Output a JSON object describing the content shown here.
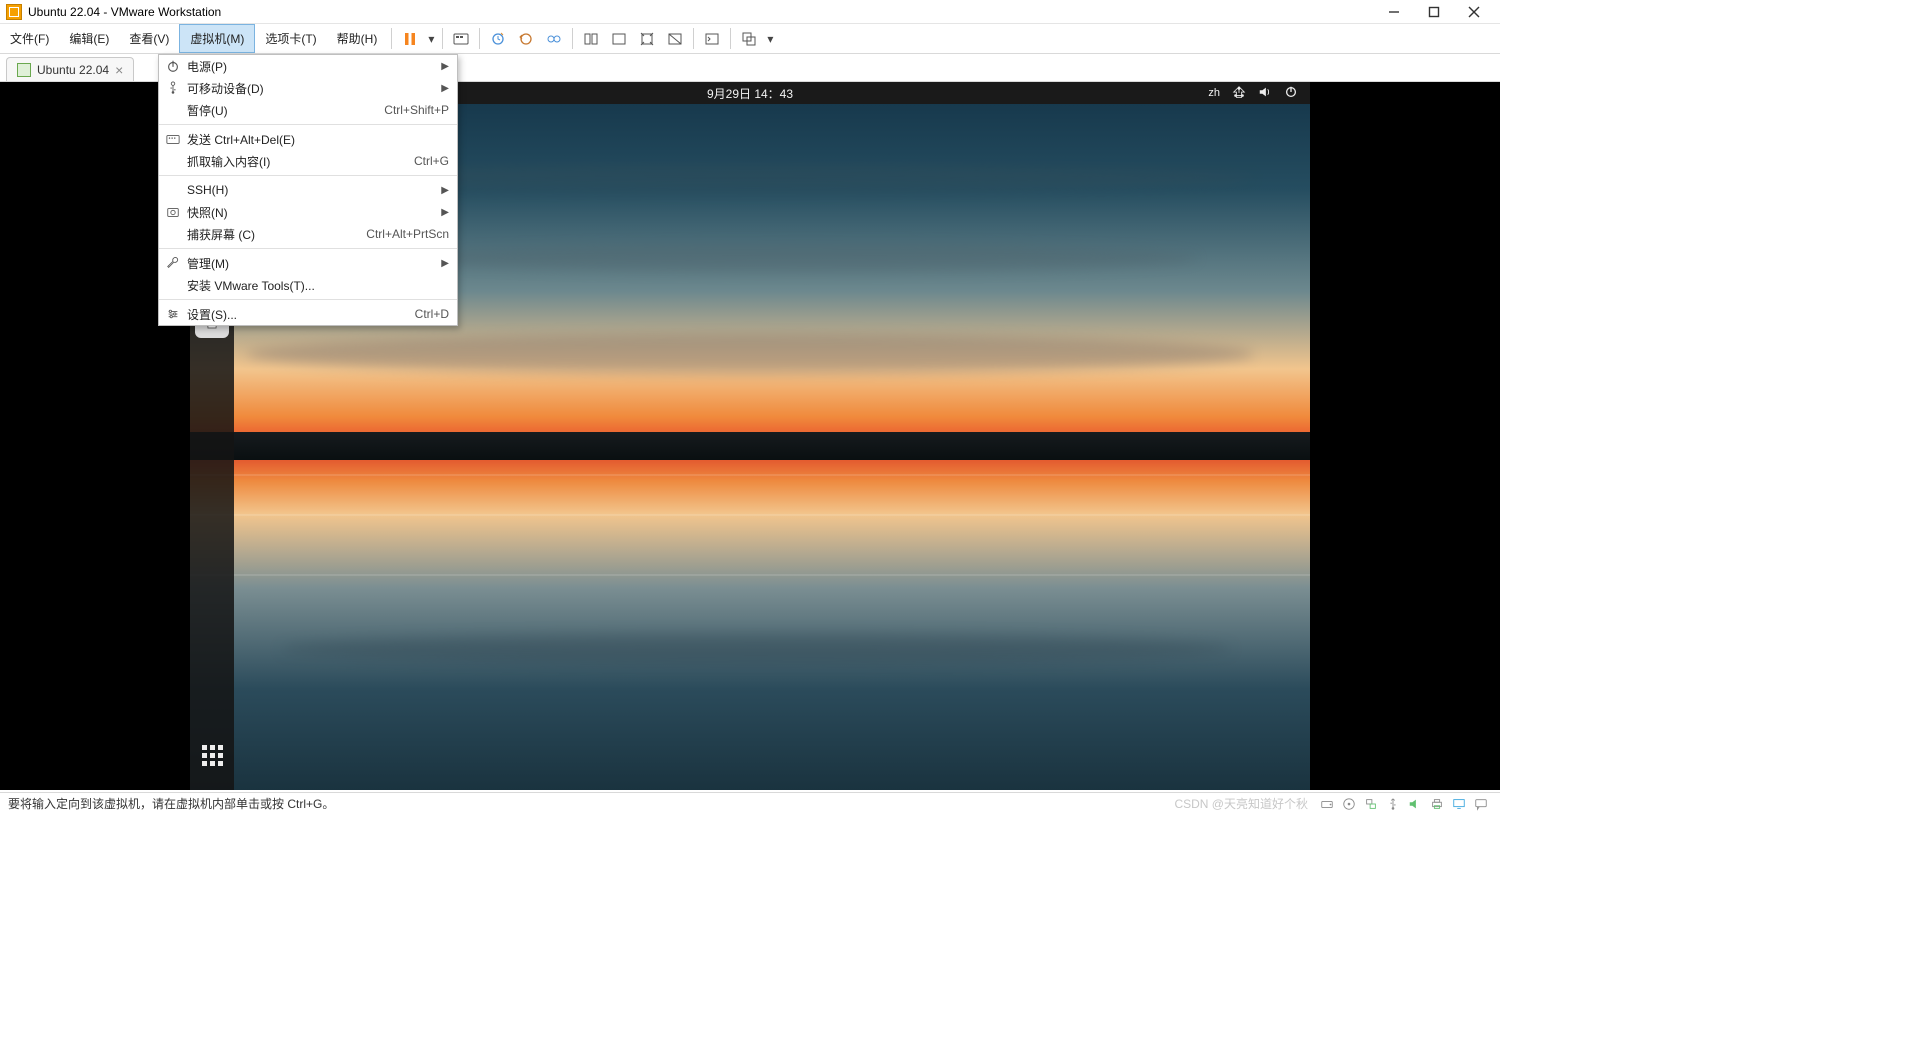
{
  "window": {
    "title": "Ubuntu 22.04 - VMware Workstation"
  },
  "menu": {
    "items": [
      {
        "label": "文件(F)"
      },
      {
        "label": "编辑(E)"
      },
      {
        "label": "查看(V)"
      },
      {
        "label": "虚拟机(M)"
      },
      {
        "label": "选项卡(T)"
      },
      {
        "label": "帮助(H)"
      }
    ],
    "active_index": 3
  },
  "tab": {
    "label": "Ubuntu 22.04"
  },
  "dropdown": {
    "rows": [
      {
        "icon": "power-icon",
        "label": "电源(P)",
        "shortcut": "",
        "submenu": true
      },
      {
        "icon": "usb-icon",
        "label": "可移动设备(D)",
        "shortcut": "",
        "submenu": true
      },
      {
        "icon": "",
        "label": "暂停(U)",
        "shortcut": "Ctrl+Shift+P",
        "submenu": false
      },
      {
        "sep": true
      },
      {
        "icon": "send-keys-icon",
        "label": "发送 Ctrl+Alt+Del(E)",
        "shortcut": "",
        "submenu": false
      },
      {
        "icon": "",
        "label": "抓取输入内容(I)",
        "shortcut": "Ctrl+G",
        "submenu": false
      },
      {
        "sep": true
      },
      {
        "icon": "",
        "label": "SSH(H)",
        "shortcut": "",
        "submenu": true
      },
      {
        "icon": "snapshot-icon",
        "label": "快照(N)",
        "shortcut": "",
        "submenu": true
      },
      {
        "icon": "",
        "label": "捕获屏幕 (C)",
        "shortcut": "Ctrl+Alt+PrtScn",
        "submenu": false
      },
      {
        "sep": true
      },
      {
        "icon": "wrench-icon",
        "label": "管理(M)",
        "shortcut": "",
        "submenu": true
      },
      {
        "icon": "",
        "label": "安装 VMware Tools(T)...",
        "shortcut": "",
        "submenu": false
      },
      {
        "sep": true
      },
      {
        "icon": "settings-icon",
        "label": "设置(S)...",
        "shortcut": "Ctrl+D",
        "submenu": false
      }
    ]
  },
  "ubuntu": {
    "clock": "9月29日  14：43",
    "lang": "zh"
  },
  "statusbar": {
    "text": "要将输入定向到该虚拟机，请在虚拟机内部单击或按 Ctrl+G。",
    "watermark": "CSDN @天亮知道好个秋"
  }
}
